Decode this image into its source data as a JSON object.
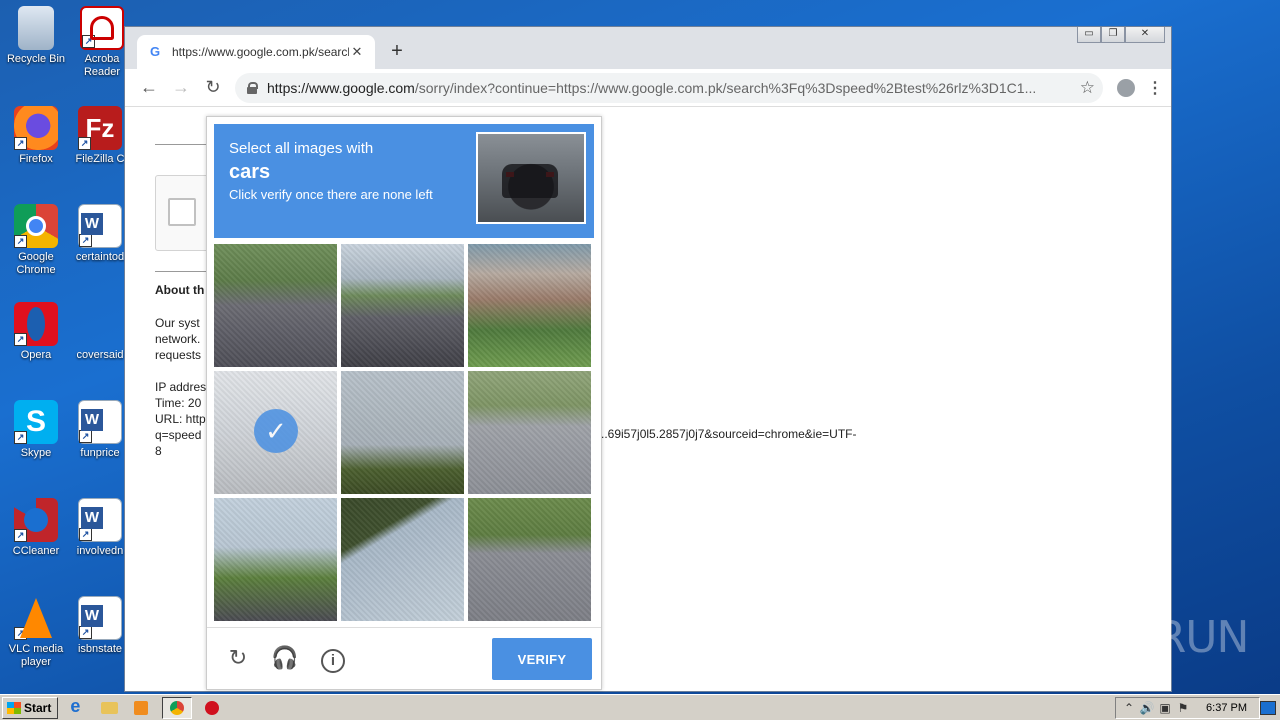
{
  "desktop": {
    "icons": [
      {
        "label": "Recycle Bin",
        "icon": "recycle-bin-icon"
      },
      {
        "label": "Acroba Reader",
        "icon": "acrobat-reader-icon"
      },
      {
        "label": "Firefox",
        "icon": "firefox-icon"
      },
      {
        "label": "FileZilla C",
        "icon": "filezilla-icon"
      },
      {
        "label": "Google Chrome",
        "icon": "chrome-icon"
      },
      {
        "label": "certaintod",
        "icon": "word-document-icon"
      },
      {
        "label": "Opera",
        "icon": "opera-icon"
      },
      {
        "label": "coversaid",
        "icon": "word-document-icon"
      },
      {
        "label": "Skype",
        "icon": "skype-icon"
      },
      {
        "label": "funprice",
        "icon": "word-document-icon"
      },
      {
        "label": "CCleaner",
        "icon": "ccleaner-icon"
      },
      {
        "label": "involvedn",
        "icon": "word-document-icon"
      },
      {
        "label": "VLC media player",
        "icon": "vlc-icon"
      },
      {
        "label": "isbnstate",
        "icon": "word-document-icon"
      }
    ]
  },
  "browser": {
    "tab_title": "https://www.google.com.pk/search?",
    "favicon": "G",
    "close_glyph": "✕",
    "new_tab_glyph": "+",
    "window_buttons": [
      "▭",
      "❐",
      "✕"
    ],
    "url_host": "https://www.google.com",
    "url_path": "/sorry/index?continue=https://www.google.com.pk/search%3Fq%3Dspeed%2Btest%26rlz%3D1C1...",
    "back_glyph": "←",
    "forward_glyph": "→",
    "reload_glyph": "↻",
    "star_glyph": "☆",
    "menu_glyph": "⋮"
  },
  "page": {
    "about_heading": "About th",
    "text_lines": [
      "Our syst",
      "network.",
      "requests"
    ],
    "info_lines": [
      "IP addres",
      "Time: 20",
      "URL: http",
      "q=speed",
      "8"
    ],
    "url_tail": "..69i57j0l5.2857j0j7&sourceid=chrome&ie=UTF-"
  },
  "captcha": {
    "instruction_line1": "Select all images with",
    "target_word": "cars",
    "instruction_line3": "Click verify once there are none left",
    "selected_tiles": [
      3
    ],
    "tile_count": 9,
    "check_glyph": "✓",
    "reload_glyph": "↻",
    "audio_glyph": "🎧",
    "info_glyph": "i",
    "verify_label": "VERIFY",
    "accent_color": "#4a90e2"
  },
  "watermark": "ANY▷RUN",
  "taskbar": {
    "start_label": "Start",
    "tray_icons": [
      "⌃",
      "🔊",
      "▣",
      "⚑"
    ],
    "clock": "6:37 PM"
  }
}
